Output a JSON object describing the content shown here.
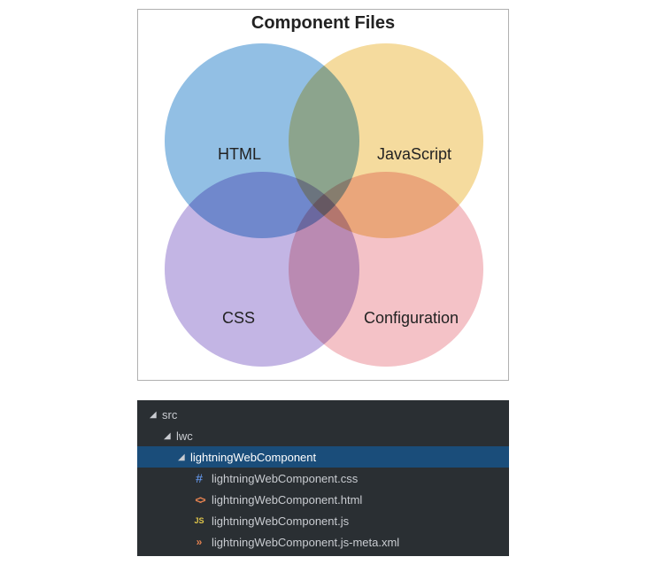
{
  "venn": {
    "title": "Component Files",
    "circles": {
      "html": {
        "label": "HTML"
      },
      "js": {
        "label": "JavaScript"
      },
      "css": {
        "label": "CSS"
      },
      "cfg": {
        "label": "Configuration"
      }
    }
  },
  "tree": {
    "rows": [
      {
        "name": "src",
        "type": "folder",
        "indent": 0,
        "expanded": true,
        "selected": false,
        "icon": "chevron"
      },
      {
        "name": "lwc",
        "type": "folder",
        "indent": 1,
        "expanded": true,
        "selected": false,
        "icon": "chevron"
      },
      {
        "name": "lightningWebComponent",
        "type": "folder",
        "indent": 2,
        "expanded": true,
        "selected": true,
        "icon": "chevron"
      },
      {
        "name": "lightningWebComponent.css",
        "type": "file",
        "indent": 3,
        "selected": false,
        "icon": "css"
      },
      {
        "name": "lightningWebComponent.html",
        "type": "file",
        "indent": 3,
        "selected": false,
        "icon": "html"
      },
      {
        "name": "lightningWebComponent.js",
        "type": "file",
        "indent": 3,
        "selected": false,
        "icon": "js"
      },
      {
        "name": "lightningWebComponent.js-meta.xml",
        "type": "file",
        "indent": 3,
        "selected": false,
        "icon": "xml"
      }
    ]
  },
  "icons": {
    "chevron_glyph": "◢",
    "css_glyph": "#",
    "html_glyph": "<>",
    "js_glyph": "JS",
    "xml_glyph": "»"
  },
  "chart_data": {
    "type": "venn",
    "title": "Component Files",
    "sets": [
      {
        "id": "HTML",
        "label": "HTML"
      },
      {
        "id": "JavaScript",
        "label": "JavaScript"
      },
      {
        "id": "CSS",
        "label": "CSS"
      },
      {
        "id": "Configuration",
        "label": "Configuration"
      }
    ],
    "layout": "2x2-overlap",
    "note": "Four equal circles arranged in a 2x2 grid with mutual overlaps; no numeric values shown."
  }
}
